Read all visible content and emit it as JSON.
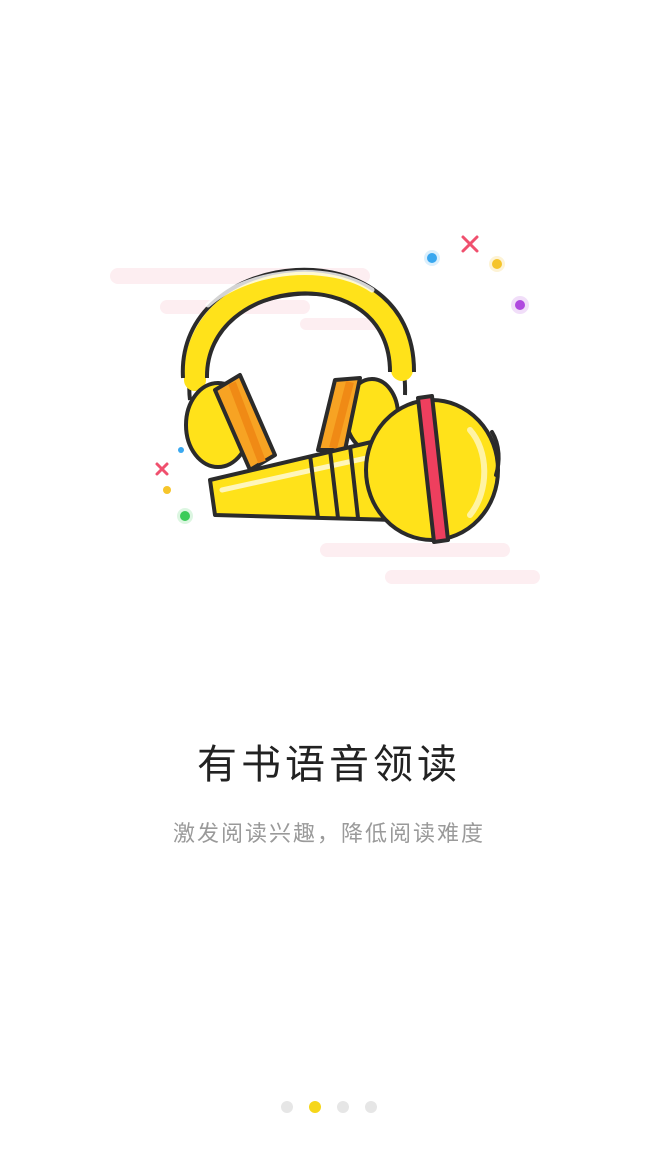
{
  "onboarding": {
    "title": "有书语音领读",
    "subtitle": "激发阅读兴趣，降低阅读难度",
    "illustration": "headphones-and-microphone",
    "page_indicator": {
      "total": 4,
      "current": 2
    }
  },
  "colors": {
    "accent": "#f6d61a",
    "dot_inactive": "#e6e6e6",
    "title": "#222222",
    "subtitle": "#9a9a9a",
    "cloud": "#fdeef1"
  }
}
